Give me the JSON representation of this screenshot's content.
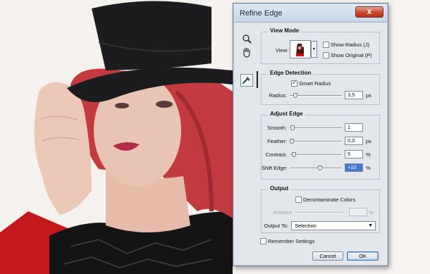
{
  "dialog": {
    "title": "Refine Edge",
    "close_label": "x"
  },
  "tools": {
    "zoom": "zoom-icon",
    "hand": "hand-icon",
    "refine_radius": "refine-radius-brush-icon"
  },
  "view_mode": {
    "heading": "View Mode",
    "view_label": "View:",
    "show_radius_label": "Show Radius (J)",
    "show_radius_checked": false,
    "show_original_label": "Show Original (P)",
    "show_original_checked": false
  },
  "edge_detection": {
    "heading": "Edge Detection",
    "smart_radius_label": "Smart Radius",
    "smart_radius_checked": true,
    "radius_label": "Radius:",
    "radius_value": "3,5",
    "radius_unit": "px",
    "radius_slider_fraction": 0.08
  },
  "adjust_edge": {
    "heading": "Adjust Edge",
    "smooth_label": "Smooth:",
    "smooth_value": "1",
    "smooth_slider_fraction": 0.02,
    "feather_label": "Feather:",
    "feather_value": "0,0",
    "feather_unit": "px",
    "feather_slider_fraction": 0.0,
    "contrast_label": "Contrast:",
    "contrast_value": "5",
    "contrast_unit": "%",
    "contrast_slider_fraction": 0.05,
    "shift_edge_label": "Shift Edge:",
    "shift_edge_value": "+10",
    "shift_edge_unit": "%",
    "shift_edge_slider_fraction": 0.55
  },
  "output": {
    "heading": "Output",
    "decontaminate_label": "Decontaminate Colors",
    "decontaminate_checked": false,
    "amount_label": "Amount:",
    "amount_unit": "%",
    "output_to_label": "Output To:",
    "output_to_value": "Selection"
  },
  "remember_label": "Remember Settings",
  "remember_checked": false,
  "cancel_label": "Cancel",
  "ok_label": "OK",
  "colors": {
    "hat": "#1c1c1e",
    "hair": "#c23b3f",
    "skin": "#eac4b2",
    "dress_red": "#c4181c",
    "lace": "#111111"
  }
}
